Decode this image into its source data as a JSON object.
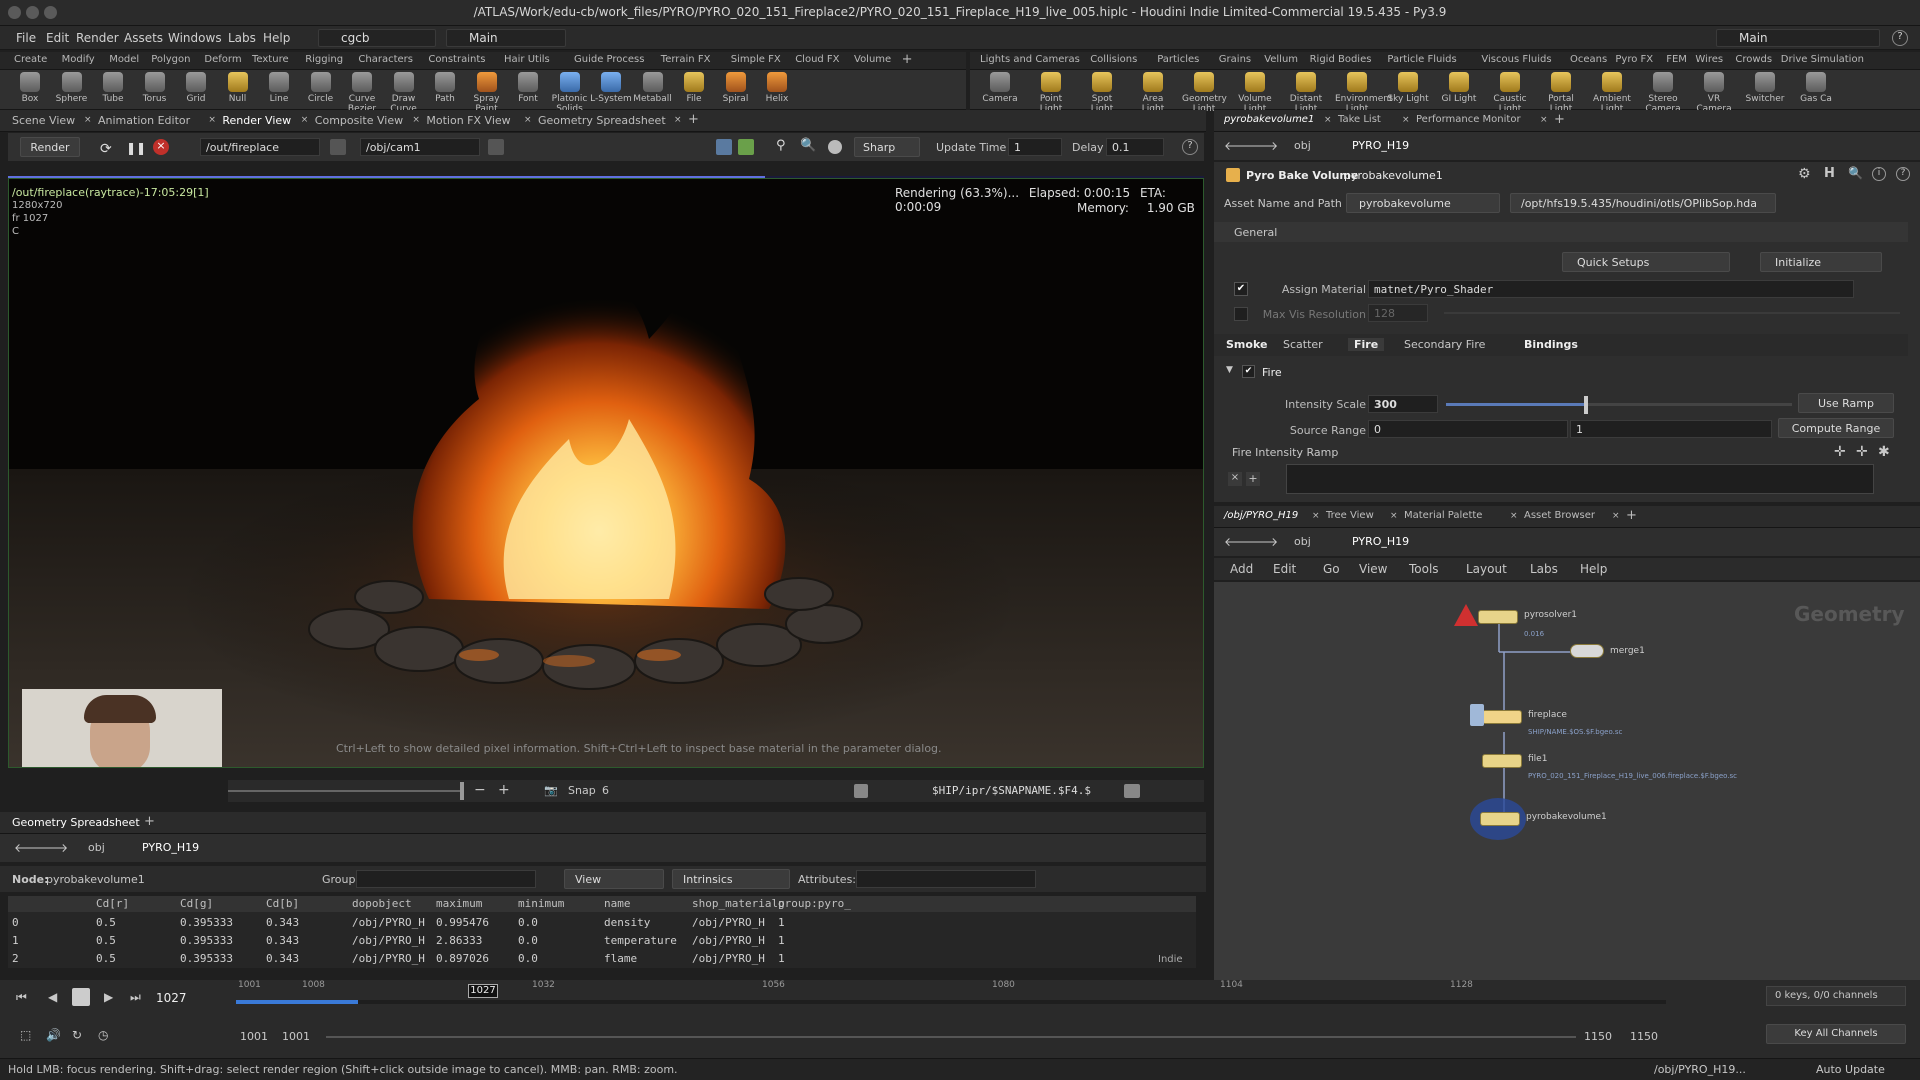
{
  "window": {
    "title": "/ATLAS/Work/edu-cb/work_files/PYRO/PYRO_020_151_Fireplace2/PYRO_020_151_Fireplace_H19_live_005.hiplc - Houdini Indie Limited-Commercial 19.5.435 - Py3.9"
  },
  "menubar": {
    "items": [
      "File",
      "Edit",
      "Render",
      "Assets",
      "Windows",
      "Labs",
      "Help"
    ],
    "desktop": "cgcb",
    "desk": "Main",
    "desk_right": "Main"
  },
  "shelf_tabs_left": [
    "Create",
    "Modify",
    "Model",
    "Polygon",
    "Deform",
    "Texture",
    "Rigging",
    "Characters",
    "Constraints",
    "Hair Utils",
    "Guide Process",
    "Terrain FX",
    "Simple FX",
    "Cloud FX",
    "Volume"
  ],
  "shelf_tabs_right": [
    "Lights and Cameras",
    "Collisions",
    "Particles",
    "Grains",
    "Vellum",
    "Rigid Bodies",
    "Particle Fluids",
    "Viscous Fluids",
    "Oceans",
    "Pyro FX",
    "FEM",
    "Wires",
    "Crowds",
    "Drive Simulation"
  ],
  "shelf_tools_left": [
    "Box",
    "Sphere",
    "Tube",
    "Torus",
    "Grid",
    "Null",
    "Line",
    "Circle",
    "Curve Bezier",
    "Draw Curve",
    "Path",
    "Spray Paint",
    "Font",
    "Platonic Solids",
    "L-System",
    "Metaball",
    "File",
    "Spiral",
    "Helix"
  ],
  "shelf_tools_right": [
    "Camera",
    "Point Light",
    "Spot Light",
    "Area Light",
    "Geometry Light",
    "Volume Light",
    "Distant Light",
    "Environment Light",
    "Sky Light",
    "GI Light",
    "Caustic Light",
    "Portal Light",
    "Ambient Light",
    "Stereo Camera",
    "VR Camera",
    "Switcher",
    "Gas Ca"
  ],
  "left_pane_tabs": [
    "Scene View",
    "Animation Editor",
    "Render View",
    "Composite View",
    "Motion FX View",
    "Geometry Spreadsheet"
  ],
  "render_toolbar": {
    "render_label": "Render",
    "out_path": "/out/fireplace",
    "camera": "/obj/cam1",
    "quality": "Sharp",
    "update_time_label": "Update Time",
    "update_time": "1",
    "delay_label": "Delay",
    "delay": "0.1"
  },
  "viewport": {
    "render_name": "/out/fireplace(raytrace)-17:05:29[1]",
    "resolution": "1280x720",
    "frame": "fr 1027",
    "channel": "C",
    "status": "Rendering (63.3%)...",
    "elapsed": "Elapsed: 0:00:15",
    "eta": "ETA: 0:00:09",
    "memory_label": "Memory:",
    "memory": "1.90 GB",
    "hint": "Ctrl+Left to show detailed pixel information. Shift+Ctrl+Left to inspect base material in the parameter dialog.",
    "progress": 0.633
  },
  "snapshot_bar": {
    "snap_label": "Snap",
    "snap_value": "6",
    "snap_path": "$HIP/ipr/$SNAPNAME.$F4.$"
  },
  "spreadsheet": {
    "tab": "Geometry Spreadsheet",
    "path_root": "obj",
    "path_node": "PYRO_H19",
    "node_label": "Node:",
    "node": "pyrobakevolume1",
    "group_label": "Group:",
    "view_label": "View",
    "intrinsics_label": "Intrinsics",
    "attributes_label": "Attributes:",
    "columns": [
      "",
      "Cd[r]",
      "Cd[g]",
      "Cd[b]",
      "dopobject",
      "maximum",
      "minimum",
      "name",
      "shop_materialp",
      "group:pyro_"
    ],
    "rows": [
      [
        "0",
        "0.5",
        "0.395333",
        "0.343",
        "/obj/PYRO_H",
        "0.995476",
        "0.0",
        "density",
        "/obj/PYRO_H",
        "1"
      ],
      [
        "1",
        "0.5",
        "0.395333",
        "0.343",
        "/obj/PYRO_H",
        "2.86333",
        "0.0",
        "temperature",
        "/obj/PYRO_H",
        "1"
      ],
      [
        "2",
        "0.5",
        "0.395333",
        "0.343",
        "/obj/PYRO_H",
        "0.897026",
        "0.0",
        "flame",
        "/obj/PYRO_H",
        "1"
      ]
    ],
    "indie": "Indie"
  },
  "params_tabs": [
    "pyrobakevolume1",
    "Take List",
    "Performance Monitor"
  ],
  "params": {
    "path_root": "obj",
    "path_node": "PYRO_H19",
    "node_type": "Pyro Bake Volume",
    "node_name": "pyrobakevolume1",
    "asset_label": "Asset Name and Path",
    "asset_name": "pyrobakevolume",
    "asset_path": "/opt/hfs19.5.435/houdini/otls/OPlibSop.hda",
    "general_label": "General",
    "quick_setups": "Quick Setups",
    "initialize": "Initialize",
    "assign_material_label": "Assign Material",
    "assign_material": "matnet/Pyro_Shader",
    "max_vis_label": "Max Vis Resolution",
    "max_vis": "128",
    "subtabs": [
      "Smoke",
      "Scatter",
      "Fire",
      "Secondary Fire",
      "Bindings"
    ],
    "fire_label": "Fire",
    "intensity_label": "Intensity Scale",
    "intensity": "300",
    "intensity_slider": 0.4,
    "use_ramp": "Use Ramp",
    "source_range_label": "Source Range",
    "source_min": "0",
    "source_max": "1",
    "compute_range": "Compute Range",
    "ramp_label": "Fire Intensity Ramp"
  },
  "network_tabs": [
    "/obj/PYRO_H19",
    "Tree View",
    "Material Palette",
    "Asset Browser"
  ],
  "network": {
    "path_root": "obj",
    "path_node": "PYRO_H19",
    "menu": [
      "Add",
      "Edit",
      "Go",
      "View",
      "Tools",
      "Layout",
      "Labs",
      "Help"
    ],
    "context_label": "Geometry",
    "nodes": [
      {
        "name": "pyrosolver1",
        "sub": "0.016"
      },
      {
        "name": "merge1",
        "sub": ""
      },
      {
        "name": "fireplace",
        "sub": "SHIP/NAME.$OS.$F.bgeo.sc"
      },
      {
        "name": "file1",
        "sub": "PYRO_020_151_Fireplace_H19_live_006.fireplace.$F.bgeo.sc"
      },
      {
        "name": "pyrobakevolume1",
        "sub": ""
      }
    ]
  },
  "timeline": {
    "current_frame": "1027",
    "ticks": [
      "1001",
      "1008",
      "1032",
      "1056",
      "1080",
      "1104",
      "1128"
    ],
    "range_start": "1001",
    "range_start2": "1001",
    "range_end": "1150",
    "range_end2": "1150",
    "keys_label": "0 keys, 0/0 channels",
    "key_all": "Key All Channels"
  },
  "statusbar": {
    "hint": "Hold LMB: focus rendering. Shift+drag: select render region (Shift+click outside image to cancel). MMB: pan. RMB: zoom.",
    "path": "/obj/PYRO_H19...",
    "auto_update": "Auto Update"
  }
}
